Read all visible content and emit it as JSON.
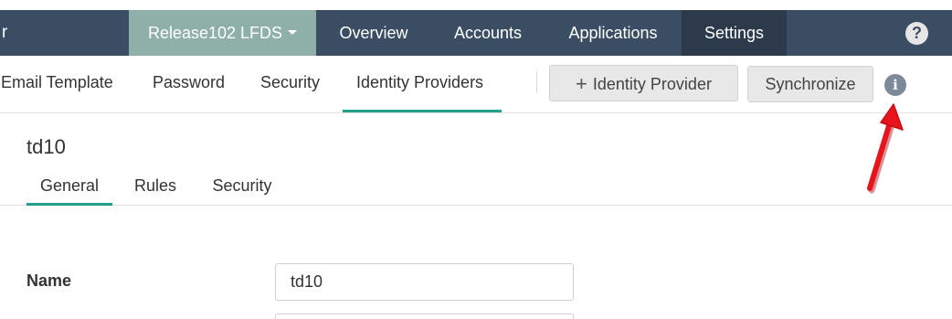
{
  "topnav": {
    "brand_tail": "r",
    "environment": "Release102 LFDS",
    "items": [
      {
        "label": "Overview"
      },
      {
        "label": "Accounts"
      },
      {
        "label": "Applications"
      },
      {
        "label": "Settings"
      }
    ],
    "help_glyph": "?"
  },
  "subnav": {
    "items": [
      {
        "label": "Email Template"
      },
      {
        "label": "Password"
      },
      {
        "label": "Security"
      },
      {
        "label": "Identity Providers"
      }
    ],
    "add_button": {
      "icon": "+",
      "label": "Identity Provider"
    },
    "sync_button": {
      "label": "Synchronize"
    },
    "info_glyph": "i"
  },
  "detail": {
    "title": "td10",
    "tabs": [
      {
        "label": "General"
      },
      {
        "label": "Rules"
      },
      {
        "label": "Security"
      }
    ],
    "name_label": "Name",
    "name_value": "td10"
  },
  "colors": {
    "topnav_bg": "#3b4d63",
    "env_bg": "#8fb0a8",
    "active_nav_bg": "#2c3a4c",
    "accent": "#23a08a",
    "annotation_arrow": "#e8141b"
  },
  "icons": {
    "dropdown": "caret-down-icon",
    "help": "question-circle-icon",
    "add": "plus-icon",
    "info": "info-circle-icon",
    "annotation": "red-arrow-icon"
  }
}
